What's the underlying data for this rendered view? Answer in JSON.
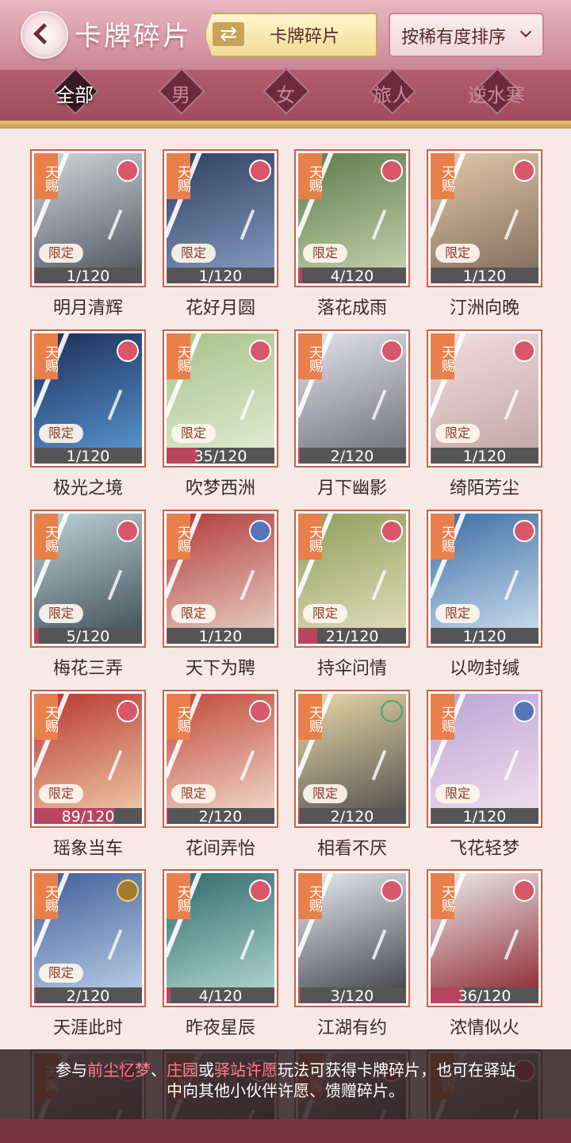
{
  "header": {
    "title": "卡牌碎片",
    "swap_label": "卡牌碎片",
    "swap_icon": "⇄",
    "sort_label": "按稀有度排序"
  },
  "tabs": [
    {
      "label": "全部",
      "active": true
    },
    {
      "label": "男",
      "active": false
    },
    {
      "label": "女",
      "active": false
    },
    {
      "label": "旅人",
      "active": false
    },
    {
      "label": "逆水寒",
      "active": false
    }
  ],
  "cards": [
    {
      "name": "明月清辉",
      "progress": "1/120",
      "value": 1,
      "tag": "天赐",
      "limited": "限定",
      "badge": "flower",
      "palette": [
        "#cfd6db",
        "#4a4f5a"
      ]
    },
    {
      "name": "花好月圆",
      "progress": "1/120",
      "value": 1,
      "tag": "天赐",
      "limited": "限定",
      "badge": "flower",
      "palette": [
        "#2f3f5f",
        "#8aa0c6"
      ]
    },
    {
      "name": "落花成雨",
      "progress": "4/120",
      "value": 4,
      "tag": "天赐",
      "limited": "限定",
      "badge": "flower",
      "palette": [
        "#5e7a4a",
        "#c9d7b4"
      ]
    },
    {
      "name": "汀洲向晚",
      "progress": "1/120",
      "value": 1,
      "tag": "天赐",
      "limited": "限定",
      "badge": "flower",
      "palette": [
        "#e5c7a8",
        "#7b6a5a"
      ]
    },
    {
      "name": "极光之境",
      "progress": "1/120",
      "value": 1,
      "tag": "天赐",
      "limited": "限定",
      "badge": "flower",
      "palette": [
        "#1c2d58",
        "#5b9bd6"
      ]
    },
    {
      "name": "吹梦西洲",
      "progress": "35/120",
      "value": 35,
      "tag": "天赐",
      "limited": "限定",
      "badge": "flower",
      "palette": [
        "#a7c28a",
        "#e3eed8"
      ]
    },
    {
      "name": "月下幽影",
      "progress": "2/120",
      "value": 2,
      "tag": "天赐",
      "limited": "",
      "badge": "flower",
      "palette": [
        "#e4e4ea",
        "#6a6a7a"
      ]
    },
    {
      "name": "绮陌芳尘",
      "progress": "1/120",
      "value": 1,
      "tag": "天赐",
      "limited": "限定",
      "badge": "flower",
      "palette": [
        "#f2dde2",
        "#c0a4a0"
      ]
    },
    {
      "name": "梅花三弄",
      "progress": "5/120",
      "value": 5,
      "tag": "天赐",
      "limited": "限定",
      "badge": "flower",
      "palette": [
        "#bcd3d6",
        "#3b4a52"
      ]
    },
    {
      "name": "天下为聘",
      "progress": "1/120",
      "value": 1,
      "tag": "天赐",
      "limited": "限定",
      "badge": "fan",
      "palette": [
        "#b33a3a",
        "#e8d8cc"
      ]
    },
    {
      "name": "持伞问情",
      "progress": "21/120",
      "value": 21,
      "tag": "天赐",
      "limited": "限定",
      "badge": "flower",
      "palette": [
        "#8f9e5a",
        "#e5e2c2"
      ]
    },
    {
      "name": "以吻封缄",
      "progress": "1/120",
      "value": 1,
      "tag": "天赐",
      "limited": "限定",
      "badge": "flower",
      "palette": [
        "#3c6ea5",
        "#d2e3f0"
      ]
    },
    {
      "name": "瑶象当车",
      "progress": "89/120",
      "value": 89,
      "tag": "天赐",
      "limited": "限定",
      "badge": "flower",
      "palette": [
        "#b8362f",
        "#f1d2b0"
      ]
    },
    {
      "name": "花间弄怡",
      "progress": "2/120",
      "value": 2,
      "tag": "天赐",
      "limited": "限定",
      "badge": "flower",
      "palette": [
        "#c2473a",
        "#f2e2d2"
      ]
    },
    {
      "name": "相看不厌",
      "progress": "2/120",
      "value": 2,
      "tag": "天赐",
      "limited": "限定",
      "badge": "green",
      "palette": [
        "#ead9a8",
        "#4a4a4a"
      ]
    },
    {
      "name": "飞花轻梦",
      "progress": "1/120",
      "value": 1,
      "tag": "天赐",
      "limited": "限定",
      "badge": "fan",
      "palette": [
        "#b9a5d6",
        "#f6e1ee"
      ]
    },
    {
      "name": "天涯此时",
      "progress": "2/120",
      "value": 2,
      "tag": "天赐",
      "limited": "限定",
      "badge": "coin",
      "palette": [
        "#3e5f9a",
        "#c2d4ea"
      ]
    },
    {
      "name": "昨夜星辰",
      "progress": "4/120",
      "value": 4,
      "tag": "天赐",
      "limited": "",
      "badge": "flower",
      "palette": [
        "#2f6b6b",
        "#b9dcd6"
      ]
    },
    {
      "name": "江湖有约",
      "progress": "3/120",
      "value": 3,
      "tag": "天赐",
      "limited": "",
      "badge": "flower",
      "palette": [
        "#e8ecef",
        "#3a3a46"
      ]
    },
    {
      "name": "浓情似火",
      "progress": "36/120",
      "value": 36,
      "tag": "天赐",
      "limited": "",
      "badge": "flower",
      "palette": [
        "#ececec",
        "#8a1f2a"
      ]
    },
    {
      "name": "",
      "progress": "",
      "value": 0,
      "tag": "天赐",
      "limited": "",
      "badge": "flower",
      "palette": [
        "#d9c3c3",
        "#3a2f2f"
      ]
    },
    {
      "name": "",
      "progress": "",
      "value": 0,
      "tag": "天赐",
      "limited": "",
      "badge": "flower",
      "palette": [
        "#c9b6b6",
        "#3a2f2f"
      ]
    },
    {
      "name": "",
      "progress": "",
      "value": 0,
      "tag": "天赐",
      "limited": "",
      "badge": "flower",
      "palette": [
        "#d2c2c2",
        "#3a2f2f"
      ]
    },
    {
      "name": "",
      "progress": "",
      "value": 0,
      "tag": "天赐",
      "limited": "",
      "badge": "flower",
      "palette": [
        "#ddc8c8",
        "#3a2f2f"
      ]
    }
  ],
  "progress_max": 120,
  "notice": {
    "line1_a": "参与",
    "line1_hl1": "前尘忆梦",
    "line1_b": "、",
    "line1_hl2": "庄园",
    "line1_c": "或",
    "line1_hl3": "驿站许愿",
    "line1_d": "玩法可获得卡牌碎片，也可在驿站",
    "line2": "中向其他小伙伴许愿、馈赠碎片。"
  }
}
